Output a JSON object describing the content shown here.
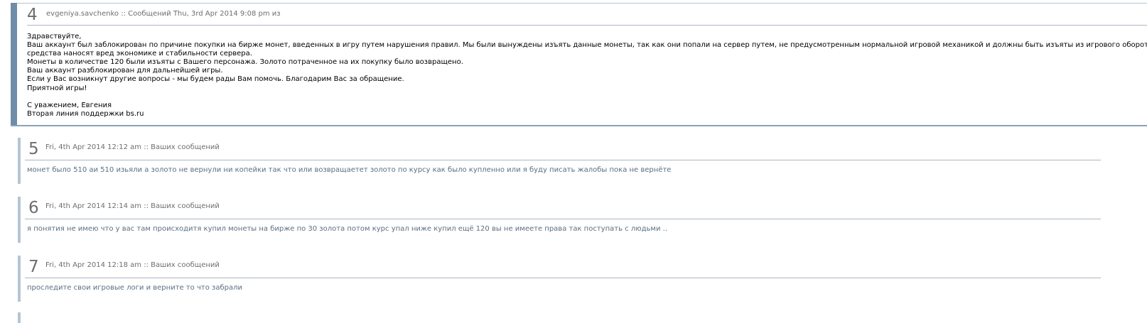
{
  "messages": [
    {
      "number": "4",
      "meta": "evgeniya.savchenko :: Сообщений Thu, 3rd Apr 2014 9:08 pm из",
      "lines": [
        "Здравствуйте,",
        "Ваш аккаунт был заблокирован по причине покупки на бирже монет, введенных в игру путем нарушения правил. Мы были вынуждены изъять данные монеты, так как они попали на сервер путем, не предусмотренным нормальной игровой механикой и должны быть изъяты из игрового оборота. Данные",
        "средства наносят вред экономике и стабильности сервера.",
        "Монеты в количестве 120 были изъяты с Вашего персонажа. Золото потраченное на их покупку было возвращено.",
        "Ваш аккаунт разблокирован для дальнейшей игры.",
        "Если у Вас возникнут другие вопросы - мы будем рады Вам помочь. Благодарим Вас за обращение.",
        "Приятной игры!",
        "",
        "С уважением, Евгения",
        "Вторая линия поддержки bs.ru"
      ]
    },
    {
      "number": "5",
      "meta": "Fri, 4th Apr 2014 12:12 am :: Ваших сообщений",
      "text": "монет было 510 аи 510 изьяли а золото не вернули ни копейки так что или возвращаетет золото по курсу как было купленно или я буду писать жалобы пока не вернёте"
    },
    {
      "number": "6",
      "meta": "Fri, 4th Apr 2014 12:14 am :: Ваших сообщений",
      "text": "я понятия не имею что у вас там происходитя купил монеты на бирже по 30 золота потом курс упал ниже купил ещё 120 вы не имеете права так поступать с людьми .."
    },
    {
      "number": "7",
      "meta": "Fri, 4th Apr 2014 12:18 am :: Ваших сообщений",
      "text": "проследите свои игровые логи и верните то что забрали"
    }
  ]
}
